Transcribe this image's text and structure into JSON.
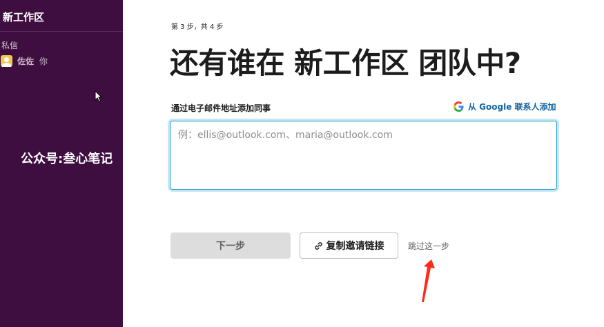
{
  "sidebar": {
    "workspace_name": "新工作区",
    "section_label": "私信",
    "dm": {
      "name": "佐佐",
      "suffix": "你"
    }
  },
  "watermark": "公众号:叁心笔记",
  "main": {
    "step_text": "第 3 步，共 4 步",
    "title": "还有谁在 新工作区 团队中?",
    "field_label": "通过电子邮件地址添加同事",
    "google_link": "从 Google 联系人添加",
    "email_placeholder": "例：ellis@outlook.com、maria@outlook.com",
    "email_value": "",
    "next_button": "下一步",
    "copy_link_button": "复制邀请链接",
    "skip_link": "跳过这一步"
  },
  "colors": {
    "sidebar_bg": "#3f0e40",
    "link": "#1264a3",
    "focus": "#1d9bd1",
    "disabled_button": "#dddddd",
    "annotation_arrow": "#ff2a1a"
  },
  "icons": [
    "user-avatar-icon",
    "mouse-cursor-icon",
    "google-logo-icon",
    "link-icon",
    "red-arrow-annotation"
  ]
}
